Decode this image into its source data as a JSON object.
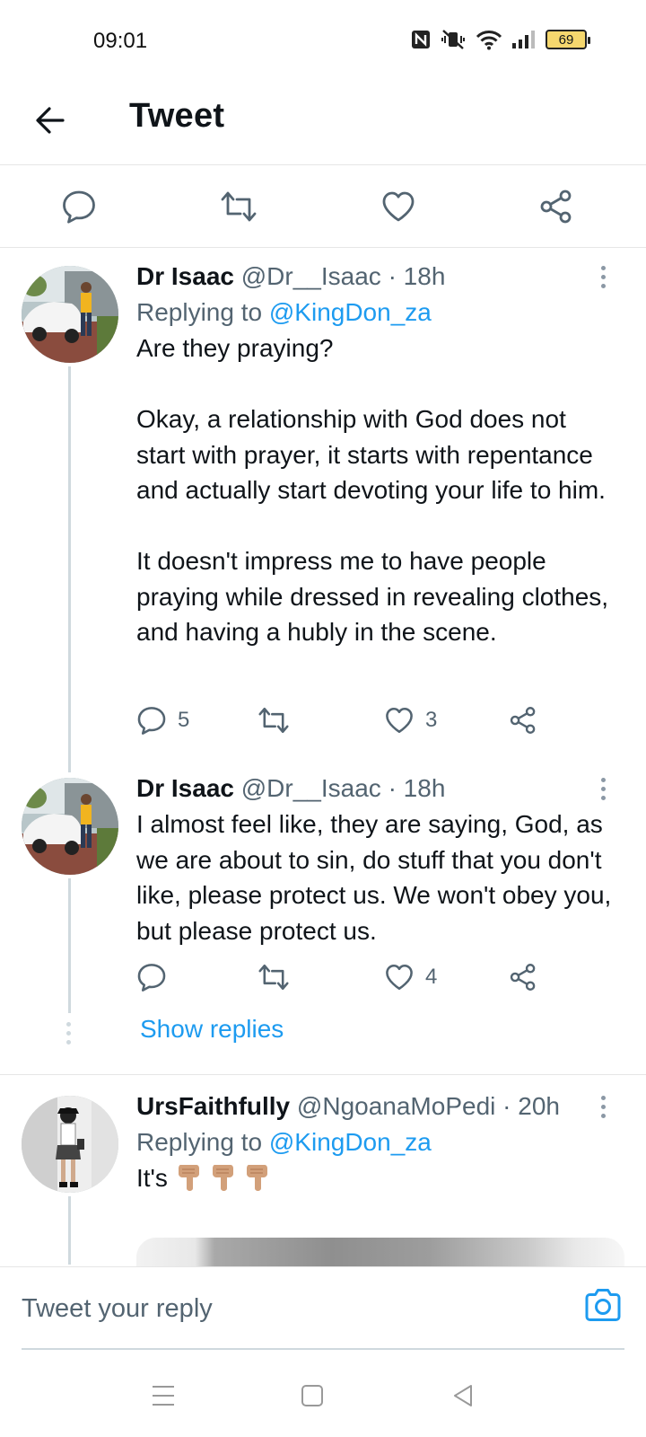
{
  "status_bar": {
    "time": "09:01",
    "battery": "69"
  },
  "header": {
    "title": "Tweet"
  },
  "tweets": [
    {
      "name": "Dr Isaac",
      "handle": "@Dr__Isaac",
      "time": "· 18h",
      "replying_prefix": "Replying to ",
      "replying_to": "@KingDon_za",
      "text": "Are they praying?\n\nOkay, a relationship with God does not start with prayer, it starts with repentance and actually start devoting your life to him.\n\nIt doesn't impress me to have people praying while dressed in revealing clothes, and having a hubly in the scene.",
      "replies": "5",
      "retweets": "",
      "likes": "3"
    },
    {
      "name": "Dr Isaac",
      "handle": "@Dr__Isaac",
      "time": "· 18h",
      "text": "I almost feel like, they are saying, God, as we are about to sin, do stuff that you don't like, please protect us. We won't obey you, but please protect us.",
      "replies": "",
      "retweets": "",
      "likes": "4"
    },
    {
      "name": "UrsFaithfully",
      "handle": "@NgoanaMoPedi",
      "time": "· 20h",
      "replying_prefix": "Replying to ",
      "replying_to": "@KingDon_za",
      "text": "It's",
      "emoji": [
        "point-down-emoji",
        "point-down-emoji",
        "point-down-emoji"
      ]
    }
  ],
  "show_replies": "Show replies",
  "reply_bar": {
    "placeholder": "Tweet your reply"
  },
  "colors": {
    "accent": "#1d9bf0",
    "muted": "#536471",
    "divider": "#e6e6e6"
  }
}
